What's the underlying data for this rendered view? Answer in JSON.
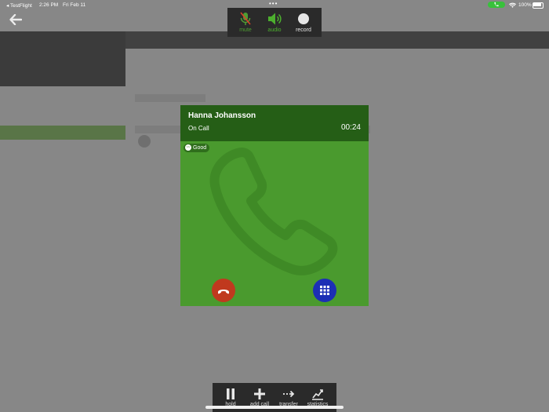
{
  "status_bar": {
    "back_app": "◂ TestFlight",
    "time": "2:26 PM",
    "date": "Fri Feb 11",
    "dots": "•••",
    "battery": "100%"
  },
  "top_controls": {
    "mute_label": "mute",
    "audio_label": "audio",
    "record_label": "record"
  },
  "call": {
    "caller_name": "Hanna Johansson",
    "status": "On Call",
    "duration": "00:24",
    "quality": "Good"
  },
  "bottom_controls": {
    "hold_label": "hold",
    "add_call_label": "add call",
    "transfer_label": "transfer",
    "statistics_label": "statistics"
  },
  "colors": {
    "card_green": "#4a9a2e",
    "header_green": "#255e16",
    "hangup_red": "#c0391e",
    "keypad_blue": "#1c2fb5",
    "accent_green": "#38c13b"
  },
  "icons": [
    "back-arrow-icon",
    "mute-icon",
    "speaker-icon",
    "record-icon",
    "phone-icon",
    "hangup-icon",
    "keypad-icon",
    "pause-icon",
    "plus-icon",
    "transfer-icon",
    "statistics-icon",
    "wifi-icon",
    "battery-icon",
    "signal-quality-icon"
  ]
}
